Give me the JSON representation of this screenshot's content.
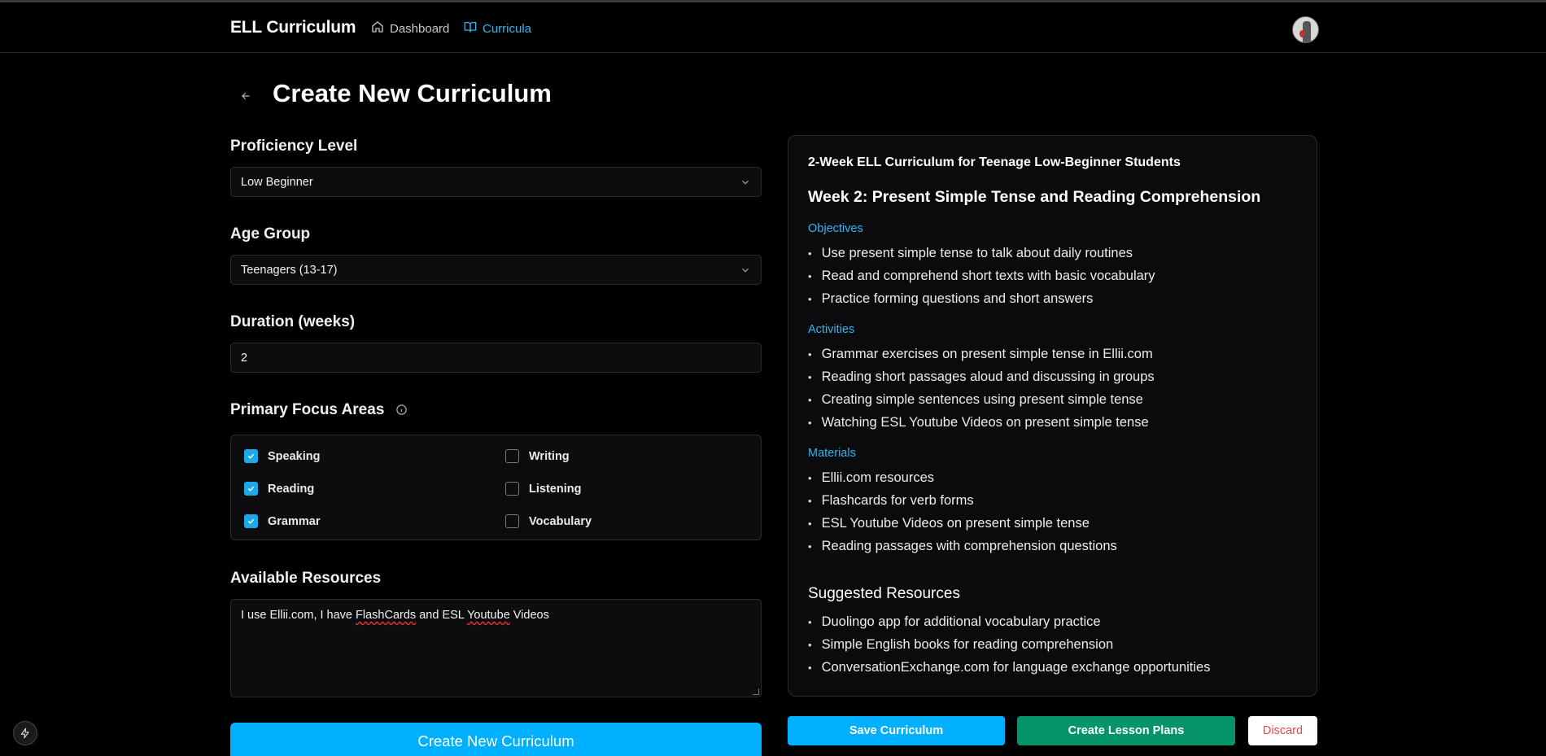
{
  "app": {
    "brand": "ELL Curriculum",
    "nav": [
      {
        "label": "Dashboard",
        "icon": "home-icon"
      },
      {
        "label": "Curricula",
        "icon": "book-icon",
        "active": true
      }
    ],
    "accent_color": "#2bb6f5"
  },
  "page": {
    "title": "Create New Curriculum"
  },
  "form": {
    "proficiency": {
      "label": "Proficiency Level",
      "value": "Low Beginner"
    },
    "age_group": {
      "label": "Age Group",
      "value": "Teenagers (13-17)"
    },
    "duration": {
      "label": "Duration (weeks)",
      "value": "2"
    },
    "focus": {
      "label": "Primary Focus Areas",
      "options": [
        {
          "label": "Speaking",
          "checked": true
        },
        {
          "label": "Writing",
          "checked": false
        },
        {
          "label": "Reading",
          "checked": true
        },
        {
          "label": "Listening",
          "checked": false
        },
        {
          "label": "Grammar",
          "checked": true
        },
        {
          "label": "Vocabulary",
          "checked": false
        }
      ]
    },
    "resources": {
      "label": "Available Resources",
      "value_parts": [
        "I use Ellii.com, I have ",
        "FlashCards",
        " and ESL ",
        "Youtube",
        " Videos"
      ]
    },
    "submit_label": "Create New Curriculum"
  },
  "preview": {
    "title": "2-Week ELL Curriculum for Teenage Low-Beginner Students",
    "week_heading": "Week 2: Present Simple Tense and Reading Comprehension",
    "objectives": {
      "label": "Objectives",
      "items": [
        "Use present simple tense to talk about daily routines",
        "Read and comprehend short texts with basic vocabulary",
        "Practice forming questions and short answers"
      ]
    },
    "activities": {
      "label": "Activities",
      "items": [
        "Grammar exercises on present simple tense in Ellii.com",
        "Reading short passages aloud and discussing in groups",
        "Creating simple sentences using present simple tense",
        "Watching ESL Youtube Videos on present simple tense"
      ]
    },
    "materials": {
      "label": "Materials",
      "items": [
        "Ellii.com resources",
        "Flashcards for verb forms",
        "ESL Youtube Videos on present simple tense",
        "Reading passages with comprehension questions"
      ]
    },
    "suggested": {
      "label": "Suggested Resources",
      "items": [
        "Duolingo app for additional vocabulary practice",
        "Simple English books for reading comprehension",
        "ConversationExchange.com for language exchange opportunities"
      ]
    }
  },
  "actions": {
    "save": "Save Curriculum",
    "lesson_plans": "Create Lesson Plans",
    "discard": "Discard"
  }
}
